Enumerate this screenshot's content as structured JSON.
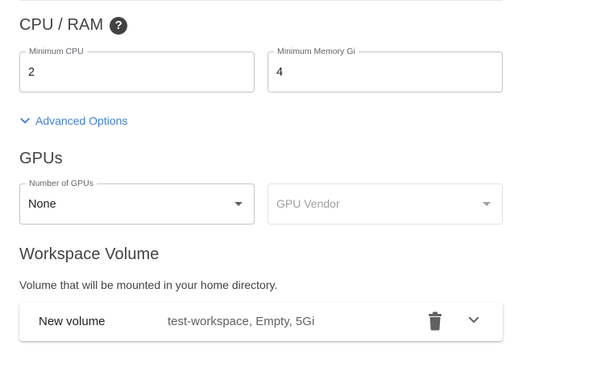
{
  "cpu_ram": {
    "title": "CPU / RAM",
    "help_icon": "help-circle-icon",
    "help_glyph": "?",
    "min_cpu": {
      "label": "Minimum CPU",
      "value": "2"
    },
    "min_memory": {
      "label": "Minimum Memory Gi",
      "value": "4"
    }
  },
  "advanced": {
    "label": "Advanced Options",
    "icon": "chevron-down-icon",
    "color": "#3f7fd8"
  },
  "gpus": {
    "title": "GPUs",
    "number_of_gpus": {
      "label": "Number of GPUs",
      "value": "None"
    },
    "gpu_vendor": {
      "placeholder": "GPU Vendor",
      "disabled": true
    }
  },
  "workspace_volume": {
    "title": "Workspace Volume",
    "description": "Volume that will be mounted in your home directory.",
    "volume": {
      "name": "New volume",
      "summary": "test-workspace, Empty, 5Gi",
      "delete_icon": "trash-icon",
      "expand_icon": "chevron-down-icon"
    }
  }
}
